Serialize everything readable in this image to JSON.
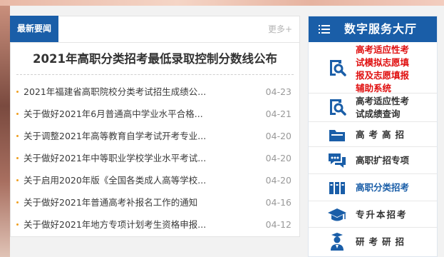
{
  "news": {
    "tab_label": "最新要闻",
    "more_label": "更多+",
    "headline": "2021年高职分类招考最低录取控制分数线公布",
    "items": [
      {
        "title": "2021年福建省高职院校分类考试招生成绩公...",
        "date": "04-23"
      },
      {
        "title": "关于做好2021年6月普通高中学业水平合格...",
        "date": "04-21"
      },
      {
        "title": "关于调整2021年高等教育自学考试开考专业...",
        "date": "04-20"
      },
      {
        "title": "关于做好2021年中等职业学校学业水平考试...",
        "date": "04-20"
      },
      {
        "title": "关于启用2020年版《全国各类成人高等学校...",
        "date": "04-20"
      },
      {
        "title": "关于做好2021年普通高考补报名工作的通知",
        "date": "04-16"
      },
      {
        "title": "关于做好2021年地方专项计划考生资格申报...",
        "date": "04-12"
      }
    ]
  },
  "services": {
    "title": "数字服务大厅",
    "items": [
      {
        "label": "高考适应性考试模拟志愿填报及志愿填报辅助系统",
        "icon": "search-doc-icon",
        "color": "#e01010"
      },
      {
        "label": "高考适应性考试成绩查询",
        "icon": "search-doc-icon",
        "color": "#333333"
      },
      {
        "label": "高考高招",
        "icon": "folder-icon",
        "color": "#333333"
      },
      {
        "label": "高职扩招专项",
        "icon": "chat-icon",
        "color": "#333333"
      },
      {
        "label": "高职分类招考",
        "icon": "books-icon",
        "color": "#1a5ea8"
      },
      {
        "label": "专升本招考",
        "icon": "graduation-cap-icon",
        "color": "#333333"
      },
      {
        "label": "研考研招",
        "icon": "graduate-icon",
        "color": "#333333"
      }
    ]
  }
}
